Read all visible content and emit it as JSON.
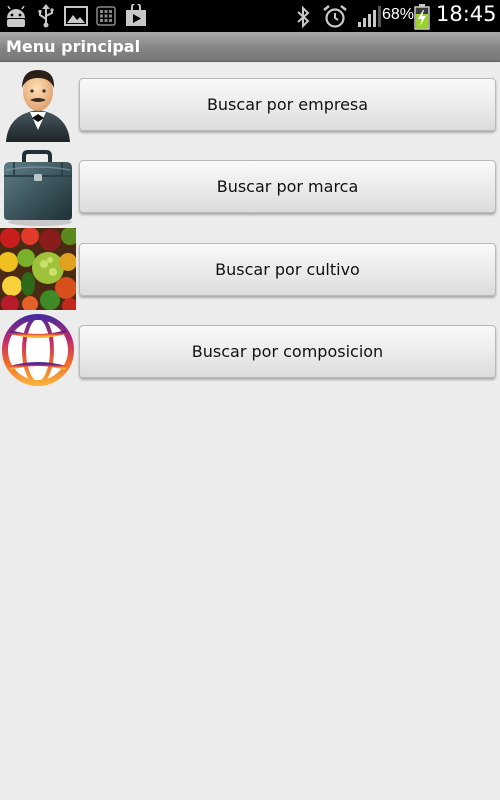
{
  "status_bar": {
    "left_icons": [
      "android-debug-icon",
      "usb-icon",
      "image-icon",
      "keyboard-icon",
      "play-store-icon"
    ],
    "right_icons": [
      "bluetooth-icon",
      "alarm-icon",
      "signal-icon",
      "battery-charging-icon"
    ],
    "battery_percent": "68%",
    "time": "18:45"
  },
  "title_bar": {
    "title": "Menu principal"
  },
  "menu": {
    "items": [
      {
        "label": "Buscar por empresa",
        "icon": "businessman-icon"
      },
      {
        "label": "Buscar por marca",
        "icon": "briefcase-icon"
      },
      {
        "label": "Buscar por cultivo",
        "icon": "fruits-vegetables-icon"
      },
      {
        "label": "Buscar por composicion",
        "icon": "globe-icon"
      }
    ]
  },
  "colors": {
    "status_bar_bg": "#000000",
    "title_bar_bg": "#8a8a8a",
    "page_bg": "#ececec",
    "button_bg": "#e8e8e8",
    "battery_green": "#9ad22c"
  }
}
